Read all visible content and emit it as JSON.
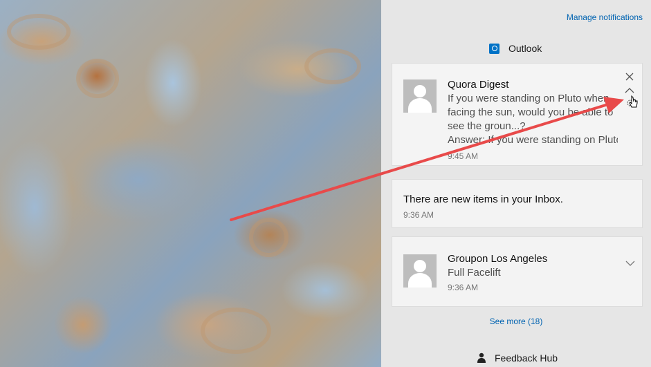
{
  "action_center": {
    "manage_notifications": "Manage notifications",
    "outlook_group": {
      "app_name": "Outlook",
      "icon": "outlook-icon"
    },
    "notifications": [
      {
        "title": "Quora Digest",
        "lines": [
          "If you were standing on Pluto when",
          "facing the sun, would you be able to",
          "see the groun...?",
          "Answer: If you were standing on Pluto"
        ],
        "time": "9:45 AM",
        "controls": [
          "close-icon",
          "chevron-up-icon",
          "gear-icon"
        ]
      },
      {
        "title": "There are new items in your Inbox.",
        "time": "9:36 AM"
      },
      {
        "title": "Groupon Los Angeles",
        "lines": [
          "Full Facelift"
        ],
        "time": "9:36 AM",
        "controls": [
          "chevron-down-icon"
        ]
      }
    ],
    "see_more": "See more (18)",
    "feedback_group": {
      "app_name": "Feedback Hub",
      "icon": "feedback-hub-icon"
    }
  },
  "annotation": {
    "arrow_color": "#e84a4a"
  },
  "colors": {
    "link": "#0063b1",
    "panel_bg": "#e6e6e6",
    "outlook_blue": "#0072c6"
  }
}
